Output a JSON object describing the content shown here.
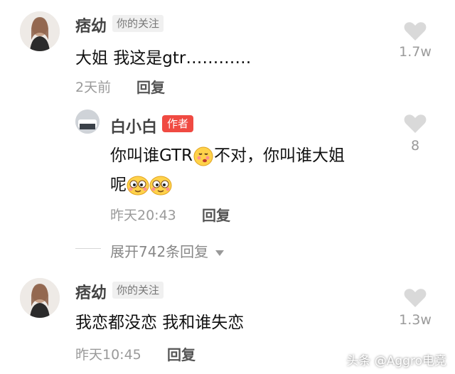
{
  "comments": [
    {
      "username": "痞幼",
      "follow_tag": "你的关注",
      "text": "大姐 我这是gtr…………",
      "time": "2天前",
      "reply_label": "回复",
      "likes": "1.7w"
    },
    {
      "username": "白小白",
      "author_tag": "作者",
      "text_part1": "你叫谁GTR",
      "text_part2": "不对，你叫谁大姐",
      "text_line2": "呢",
      "time": "昨天20:43",
      "reply_label": "回复",
      "likes": "8"
    },
    {
      "username": "痞幼",
      "follow_tag": "你的关注",
      "text": "我恋都没恋 我和谁失恋",
      "time": "昨天10:45",
      "reply_label": "回复",
      "likes": "1.3w"
    }
  ],
  "expand_replies": "展开742条回复",
  "watermark": "头条 @Aggro电竞",
  "colors": {
    "author_tag": "#f04a42",
    "heart": "#d9d9d9",
    "meta": "#9a9a9a"
  },
  "icons": [
    "heart-icon",
    "chevron-down-icon",
    "emoji-icon"
  ]
}
